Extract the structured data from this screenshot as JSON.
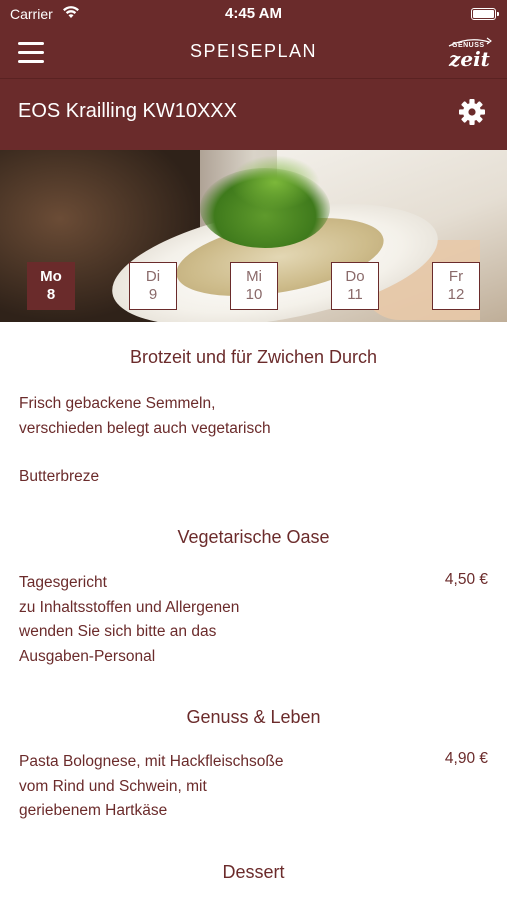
{
  "status": {
    "carrier": "Carrier",
    "time": "4:45 AM"
  },
  "nav": {
    "title": "SPEISEPLAN",
    "brand_top": "GENUSS",
    "brand_script": "zeit"
  },
  "location": {
    "title": "EOS Krailling KW10XXX"
  },
  "days": [
    {
      "name": "Mo",
      "num": "8",
      "active": true
    },
    {
      "name": "Di",
      "num": "9",
      "active": false
    },
    {
      "name": "Mi",
      "num": "10",
      "active": false
    },
    {
      "name": "Do",
      "num": "11",
      "active": false
    },
    {
      "name": "Fr",
      "num": "12",
      "active": false
    }
  ],
  "sections": [
    {
      "title": "Brotzeit und für Zwichen Durch",
      "items": [
        {
          "lines": [
            "Frisch gebackene Semmeln,",
            "verschieden belegt auch vegetarisch"
          ],
          "price": ""
        },
        {
          "lines": [
            "Butterbreze"
          ],
          "price": ""
        }
      ]
    },
    {
      "title": "Vegetarische Oase",
      "items": [
        {
          "lines": [
            "Tagesgericht",
            "zu Inhaltsstoffen und Allergenen",
            "wenden Sie sich bitte an das",
            "Ausgaben-Personal"
          ],
          "price": "4,50 €"
        }
      ]
    },
    {
      "title": "Genuss & Leben",
      "items": [
        {
          "lines": [
            "Pasta Bolognese, mit Hackfleischsoße",
            "vom Rind und Schwein, mit",
            "geriebenem Hartkäse"
          ],
          "price": "4,90 €"
        }
      ]
    },
    {
      "title": "Dessert",
      "items": []
    }
  ],
  "colors": {
    "brand": "#6a2b2b",
    "text": "#6b2b2b"
  },
  "icons": {
    "menu": "hamburger-menu-icon",
    "settings": "gear-icon",
    "wifi": "wifi-icon",
    "battery": "battery-icon"
  }
}
